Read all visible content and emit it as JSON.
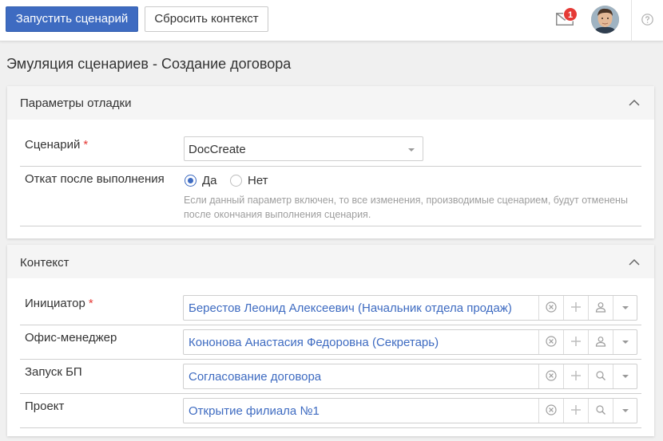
{
  "toolbar": {
    "run_label": "Запустить сценарий",
    "reset_label": "Сбросить контекст"
  },
  "header": {
    "notifications_count": "1"
  },
  "page": {
    "title": "Эмуляция сценариев - Создание договора"
  },
  "debug_panel": {
    "title": "Параметры отладки",
    "scenario_label": "Сценарий",
    "required_mark": "*",
    "scenario_value": "DocCreate",
    "rollback_label": "Откат после выполнения",
    "option_yes": "Да",
    "option_no": "Нет",
    "selected_option": "Да",
    "hint": "Если данный параметр включен, то все изменения, производимые сценарием, будут отменены после окончания выполнения сценария."
  },
  "context_panel": {
    "title": "Контекст",
    "required_mark": "*",
    "fields": [
      {
        "label": "Инициатор",
        "value": "Берестов Леонид Алексеевич (Начальник отдела продаж)",
        "action_icon": "user-icon"
      },
      {
        "label": "Офис-менеджер",
        "value": "Кононова Анастасия Федоровна (Секретарь)",
        "action_icon": "user-icon"
      },
      {
        "label": "Запуск БП",
        "value": "Согласование договора",
        "action_icon": "search-icon"
      },
      {
        "label": "Проект",
        "value": "Открытие филиала №1",
        "action_icon": "search-icon"
      }
    ]
  },
  "colors": {
    "primary": "#3e6bc1",
    "required": "#e53935",
    "badge": "#e53935",
    "hint": "#9e9e9e"
  }
}
